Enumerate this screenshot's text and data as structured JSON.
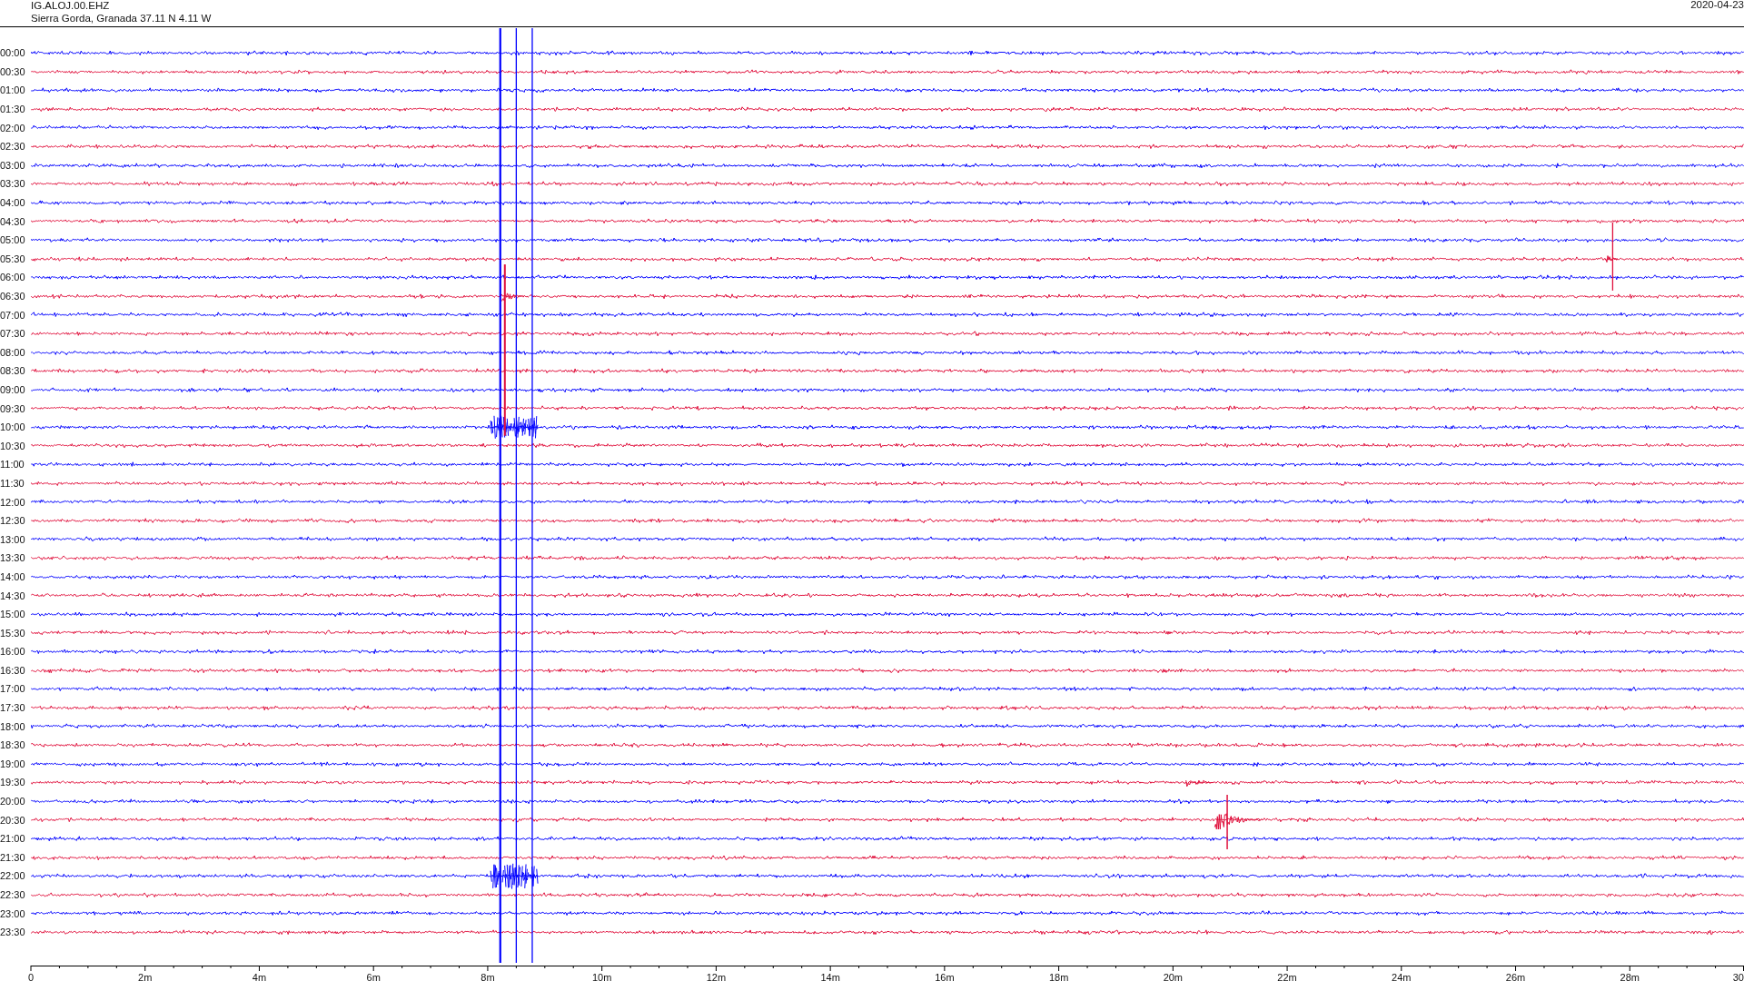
{
  "header": {
    "station": "IG.ALOJ.00.EHZ",
    "location": "Sierra Gorda, Granada  37.11 N 4.11 W",
    "date": "2020-04-23"
  },
  "rows": [
    {
      "label": "00:00",
      "color": "#0000ff"
    },
    {
      "label": "00:30",
      "color": "#e0103c"
    },
    {
      "label": "01:00",
      "color": "#0000ff"
    },
    {
      "label": "01:30",
      "color": "#e0103c"
    },
    {
      "label": "02:00",
      "color": "#0000ff"
    },
    {
      "label": "02:30",
      "color": "#e0103c"
    },
    {
      "label": "03:00",
      "color": "#0000ff"
    },
    {
      "label": "03:30",
      "color": "#e0103c"
    },
    {
      "label": "04:00",
      "color": "#0000ff"
    },
    {
      "label": "04:30",
      "color": "#e0103c"
    },
    {
      "label": "05:00",
      "color": "#0000ff"
    },
    {
      "label": "05:30",
      "color": "#e0103c"
    },
    {
      "label": "06:00",
      "color": "#0000ff"
    },
    {
      "label": "06:30",
      "color": "#e0103c"
    },
    {
      "label": "07:00",
      "color": "#0000ff"
    },
    {
      "label": "07:30",
      "color": "#e0103c"
    },
    {
      "label": "08:00",
      "color": "#0000ff"
    },
    {
      "label": "08:30",
      "color": "#e0103c"
    },
    {
      "label": "09:00",
      "color": "#0000ff"
    },
    {
      "label": "09:30",
      "color": "#e0103c"
    },
    {
      "label": "10:00",
      "color": "#0000ff"
    },
    {
      "label": "10:30",
      "color": "#e0103c"
    },
    {
      "label": "11:00",
      "color": "#0000ff"
    },
    {
      "label": "11:30",
      "color": "#e0103c"
    },
    {
      "label": "12:00",
      "color": "#0000ff"
    },
    {
      "label": "12:30",
      "color": "#e0103c"
    },
    {
      "label": "13:00",
      "color": "#0000ff"
    },
    {
      "label": "13:30",
      "color": "#e0103c"
    },
    {
      "label": "14:00",
      "color": "#0000ff"
    },
    {
      "label": "14:30",
      "color": "#e0103c"
    },
    {
      "label": "15:00",
      "color": "#0000ff"
    },
    {
      "label": "15:30",
      "color": "#e0103c"
    },
    {
      "label": "16:00",
      "color": "#0000ff"
    },
    {
      "label": "16:30",
      "color": "#e0103c"
    },
    {
      "label": "17:00",
      "color": "#0000ff"
    },
    {
      "label": "17:30",
      "color": "#e0103c"
    },
    {
      "label": "18:00",
      "color": "#0000ff"
    },
    {
      "label": "18:30",
      "color": "#e0103c"
    },
    {
      "label": "19:00",
      "color": "#0000ff"
    },
    {
      "label": "19:30",
      "color": "#e0103c"
    },
    {
      "label": "20:00",
      "color": "#0000ff"
    },
    {
      "label": "20:30",
      "color": "#e0103c"
    },
    {
      "label": "21:00",
      "color": "#0000ff"
    },
    {
      "label": "21:30",
      "color": "#e0103c"
    },
    {
      "label": "22:00",
      "color": "#0000ff"
    },
    {
      "label": "22:30",
      "color": "#e0103c"
    },
    {
      "label": "23:00",
      "color": "#0000ff"
    },
    {
      "label": "23:30",
      "color": "#e0103c"
    }
  ],
  "x_axis": {
    "ticks": [
      "0",
      "2m",
      "4m",
      "6m",
      "8m",
      "10m",
      "12m",
      "14m",
      "16m",
      "18m",
      "20m",
      "22m",
      "24m",
      "26m",
      "28m",
      "30"
    ]
  }
}
